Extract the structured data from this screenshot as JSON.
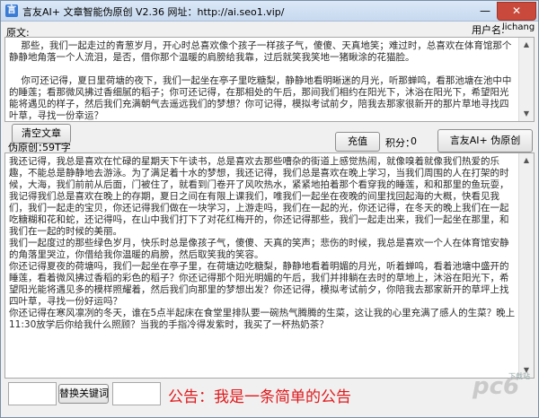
{
  "window": {
    "title": "言友AI+ 文章智能伪原创 V2.36    网址：http://ai.seo1.vip/",
    "minimize_glyph": "—",
    "close_glyph": "✕"
  },
  "header": {
    "original_label": "原文:",
    "username_label": "用户名:",
    "username_value": "lichang"
  },
  "original_text": "    那些，我们一起走过的青葱岁月，开心时总喜欢像个孩子一样孩子气，傻傻、天真地笑；难过时，总喜欢在体育馆那个静静地角落一个人流泪，是否，借你那个温暖的肩膀给我靠，过后就笑我笑地一猪瞅涂的花猫脸。\n\n    你可还记得，夏日里荷塘的夜下，我们一起坐在亭子里吃糖梨，静静地看明晰迷的月光，听那蝉鸣，看那池塘在池中中的睡莲；看那微风拂过香细腻的稻子；你可还记得，在那相处的午后，那间我们相约在阳光下，沐浴在阳光下，希望阳光能将遇见的样子，然后我们充满朝气去遥远我们的梦想？你可记得，模拟考试前夕，陪我去那家很新开的那片草地寻找四叶草，寻找一份幸运？\n\n    你可还记得，在寒风凛冽的冬天，为了旅冒一碗热气腾腾的生肉粉，是谁不顾风雨制冒五点半起床跑去排队打那份让我心里满满都是感动的生肉粉？在大晚上十一点半放学后把自己的围巾为我送上的那份关怀？在我手指冷得发紫时，为我买来的那杯热奶茶？",
  "controls": {
    "clear_button": "清空文章",
    "recharge_button": "充值",
    "points_label": "积分：",
    "points_value": "0",
    "pseudo_button": "言友AI+ 伪原创",
    "result_label": "伪原创：",
    "result_count": "59T字"
  },
  "result_text": "我还记得，我总是喜欢在忙碌的星期天下午读书，总是喜欢去那些嘈杂的街道上感觉热闹，就像嗅着就像我们热爱的乐趣，不能总是静静地去游泳。为了满足着十水的梦想，我还记得，我们总是喜欢在晚上学习，当我们周围的人在打架的时候，大海，我们前前从后面，门被住了，就看到门卷开了风吹热水，紧紧地拍着那个看穿我的睡莲，和和那里的鱼玩耍，我记得我们总是喜欢在晚上的存期，夏日之间在有限上课我们，唯我们一起坐在夜晚的间里找回起海的大概，快看见我们，我们一起走的宝贝，你还记得我们做在一块学习，上游走吗，我们在一起的光，你还记得，在冬天的晚上我们在一起吃糖糊和花和蛇，还记得吗，在山中我们打下了对花红梅开的，你还记得那些，我们一起走出来，我们一起坐在那里，和我们在一起的时候的美丽。\n我们一起度过的那些绿色岁月，快乐时总是像孩子气，傻傻、天真的笑声；悲伤的时候，我总是喜欢一个人在体育馆安静的角落里哭泣，你借给我你温暖的肩膀，然后取笑我的笑容。\n你还记得夏夜的荷塘吗，我们一起坐在亭子里，在荷塘边吃糖梨，静静地看着明媚的月光，听着蝉鸣，看着池塘中盛开的睡莲，看着微风拂过香稻的彩色的稻子？你还记得那个阳光明媚的午后，我们并排躺在去时的草地上，沐浴在阳光下，希望阳光能将遇见多的模样照耀着，然后我们向那里的梦想出发？你还记得，模拟考试前夕，你陪我去那家新开的草坪上找四叶草，寻找一份好运吗？\n你还记得在寒风凛冽的冬天，谁在5点半起床在食堂里排队要一碗热气腾腾的生菜，这让我的心里充满了感人的生菜？晚上11:30放学后你给我什么照顾？当我的手指冷得发紫时，我买了一杯热奶茶？",
  "bottom": {
    "replace_button": "替换关键词",
    "notice": "公告：我是一条简单的公告"
  },
  "watermark": {
    "text": "pc6",
    "sub": "下载站"
  },
  "scroll": {
    "up_glyph": "▲",
    "down_glyph": "▼"
  }
}
